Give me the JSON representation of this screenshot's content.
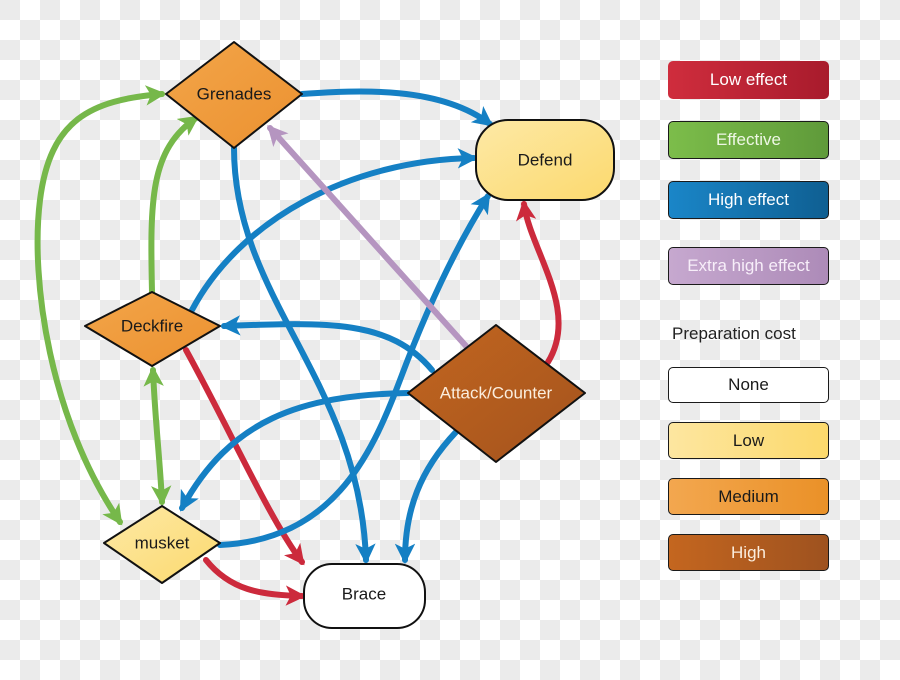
{
  "colors": {
    "low_effect": "#cc2a3c",
    "effective": "#76b84a",
    "high_effect": "#1580c4",
    "extra_high_effect": "#b595c0",
    "cost_none": "#ffffff",
    "cost_low": "#fde38e",
    "cost_medium": "#f09a3c",
    "cost_high": "#b85c1f"
  },
  "nodes": {
    "grenades": {
      "label": "Grenades",
      "cost": "Medium"
    },
    "defend": {
      "label": "Defend",
      "cost": "Low"
    },
    "deckfire": {
      "label": "Deckfire",
      "cost": "Medium"
    },
    "attack_counter": {
      "label": "Attack/Counter",
      "cost": "High"
    },
    "musket": {
      "label": "musket",
      "cost": "Low"
    },
    "brace": {
      "label": "Brace",
      "cost": "None"
    }
  },
  "edges": [
    {
      "from": "grenades",
      "to": "defend",
      "effect": "High effect"
    },
    {
      "from": "grenades",
      "to": "brace",
      "effect": "High effect"
    },
    {
      "from": "deckfire",
      "to": "grenades",
      "effect": "Effective"
    },
    {
      "from": "deckfire",
      "to": "defend",
      "effect": "High effect"
    },
    {
      "from": "deckfire",
      "to": "brace",
      "effect": "Low effect"
    },
    {
      "from": "deckfire",
      "to": "musket",
      "effect": "Effective",
      "bidirectional": true
    },
    {
      "from": "musket",
      "to": "grenades",
      "effect": "Effective",
      "bidirectional": true
    },
    {
      "from": "musket",
      "to": "defend",
      "effect": "High effect"
    },
    {
      "from": "musket",
      "to": "brace",
      "effect": "Low effect"
    },
    {
      "from": "attack_counter",
      "to": "grenades",
      "effect": "Extra high effect"
    },
    {
      "from": "attack_counter",
      "to": "defend",
      "effect": "Low effect"
    },
    {
      "from": "attack_counter",
      "to": "deckfire",
      "effect": "High effect"
    },
    {
      "from": "attack_counter",
      "to": "musket",
      "effect": "High effect"
    },
    {
      "from": "attack_counter",
      "to": "brace",
      "effect": "High effect"
    }
  ],
  "legend": {
    "effect_items": [
      {
        "label": "Low effect"
      },
      {
        "label": "Effective"
      },
      {
        "label": "High effect"
      },
      {
        "label": "Extra high effect"
      }
    ],
    "cost_title": "Preparation cost",
    "cost_items": [
      {
        "label": "None"
      },
      {
        "label": "Low"
      },
      {
        "label": "Medium"
      },
      {
        "label": "High"
      }
    ]
  }
}
